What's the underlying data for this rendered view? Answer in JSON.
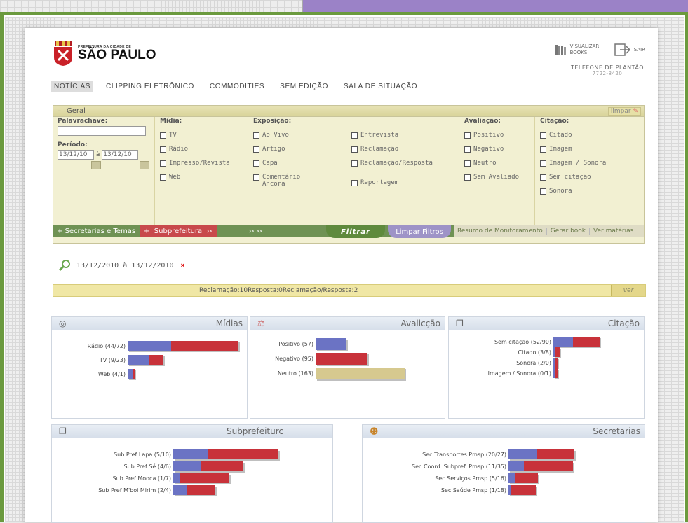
{
  "header": {
    "logo_small": "PREFEITURA DA CIDADE DE",
    "logo_big": "SÃO PAULO",
    "visualizar_books": "VISUALIZAR BOOKS",
    "sair": "SAIR",
    "telefone_label": "TELEFONE DE PLANTÃO",
    "telefone_number": "7722-8420"
  },
  "nav": {
    "items": [
      "NOTÍCIAS",
      "CLIPPING ELETRÔNICO",
      "COMMODITIES",
      "SEM EDIÇÃO",
      "SALA DE SITUAÇÃO"
    ]
  },
  "filter": {
    "section": "Geral",
    "minus": "–",
    "limpar": "limpar",
    "palavrachave": "Palavrachave:",
    "periodo": "Período:",
    "date_from": "13/12/10",
    "date_sep": "à",
    "date_to": "13/12/10",
    "midia_title": "Mídia:",
    "midia": [
      "TV",
      "Rádio",
      "Impresso/Revista",
      "Web"
    ],
    "exposicao_title": "Exposição:",
    "exposicao_a": [
      "Ao Vivo",
      "Artigo",
      "Capa",
      "Comentário Ancora"
    ],
    "exposicao_b": [
      "Entrevista",
      "Reclamação",
      "Reclamação/Resposta",
      "Reportagem"
    ],
    "avaliacao_title": "Avaliação:",
    "avaliacao": [
      "Positivo",
      "Negativo",
      "Neutro",
      "Sem Avaliado"
    ],
    "citacao_title": "Citação:",
    "citacao": [
      "Citado",
      "Imagem",
      "Imagem / Sonora",
      "Sem citação",
      "Sonora"
    ]
  },
  "tabs": {
    "secretarias": "Secretarias e Temas",
    "subprefeitura": "Subprefeitura",
    "filtrar": "Filtrar",
    "limpar_filtros": "Limpar Filtros",
    "resumo": "Resumo de Monitoramento",
    "gerar_book": "Gerar book",
    "ver_materias": "Ver matérias"
  },
  "summary": {
    "period": "13/12/2010 à 13/12/2010",
    "remove": "×",
    "bar_text": "Reclamação:10Resposta:0Reclamação/Resposta:2",
    "ver": "ver"
  },
  "colors": {
    "blue": "#6b73c4",
    "red": "#c8323a",
    "tan": "#d6c98f",
    "green": "#6f9254"
  },
  "chart_data": [
    {
      "type": "bar",
      "title": "Mídias",
      "series": [
        {
          "name": "Rádio (44/72)",
          "values": [
            28,
            44
          ]
        },
        {
          "name": "TV (9/23)",
          "values": [
            14,
            9
          ]
        },
        {
          "name": "Web (4/1)",
          "values": [
            3,
            1
          ]
        }
      ]
    },
    {
      "type": "bar",
      "title": "Avalicção",
      "series": [
        {
          "name": "Positivo (57)",
          "values": [
            57
          ]
        },
        {
          "name": "Negativo (95)",
          "values": [
            95
          ]
        },
        {
          "name": "Neutro (163)",
          "values": [
            163
          ]
        }
      ]
    },
    {
      "type": "bar",
      "title": "Citação",
      "series": [
        {
          "name": "Sem citação (52/90)",
          "values": [
            38,
            52
          ]
        },
        {
          "name": "Citado (3/8)",
          "values": [
            0,
            8
          ]
        },
        {
          "name": "Sonora (2/0)",
          "values": [
            2,
            0
          ]
        },
        {
          "name": "Imagem / Sonora (0/1)",
          "values": [
            0,
            1
          ]
        }
      ]
    },
    {
      "type": "bar",
      "title": "Subprefeiturc",
      "series": [
        {
          "name": "Sub Pref Lapa (5/10)",
          "values": [
            5,
            10
          ]
        },
        {
          "name": "Sub Pref Sé (4/6)",
          "values": [
            4,
            6
          ]
        },
        {
          "name": "Sub Pref Mooca (1/7)",
          "values": [
            1,
            7
          ]
        },
        {
          "name": "Sub Pref M'boi Mirim (2/4)",
          "values": [
            2,
            4
          ]
        }
      ]
    },
    {
      "type": "bar",
      "title": "Secretarias",
      "series": [
        {
          "name": "Sec Transportes Pmsp (20/27)",
          "values": [
            20,
            27
          ]
        },
        {
          "name": "Sec Coord. Subpref. Pmsp (11/35)",
          "values": [
            11,
            35
          ]
        },
        {
          "name": "Sec Serviços Pmsp (5/16)",
          "values": [
            5,
            16
          ]
        },
        {
          "name": "Sec Saúde Pmsp (1/18)",
          "values": [
            1,
            18
          ]
        }
      ]
    }
  ]
}
